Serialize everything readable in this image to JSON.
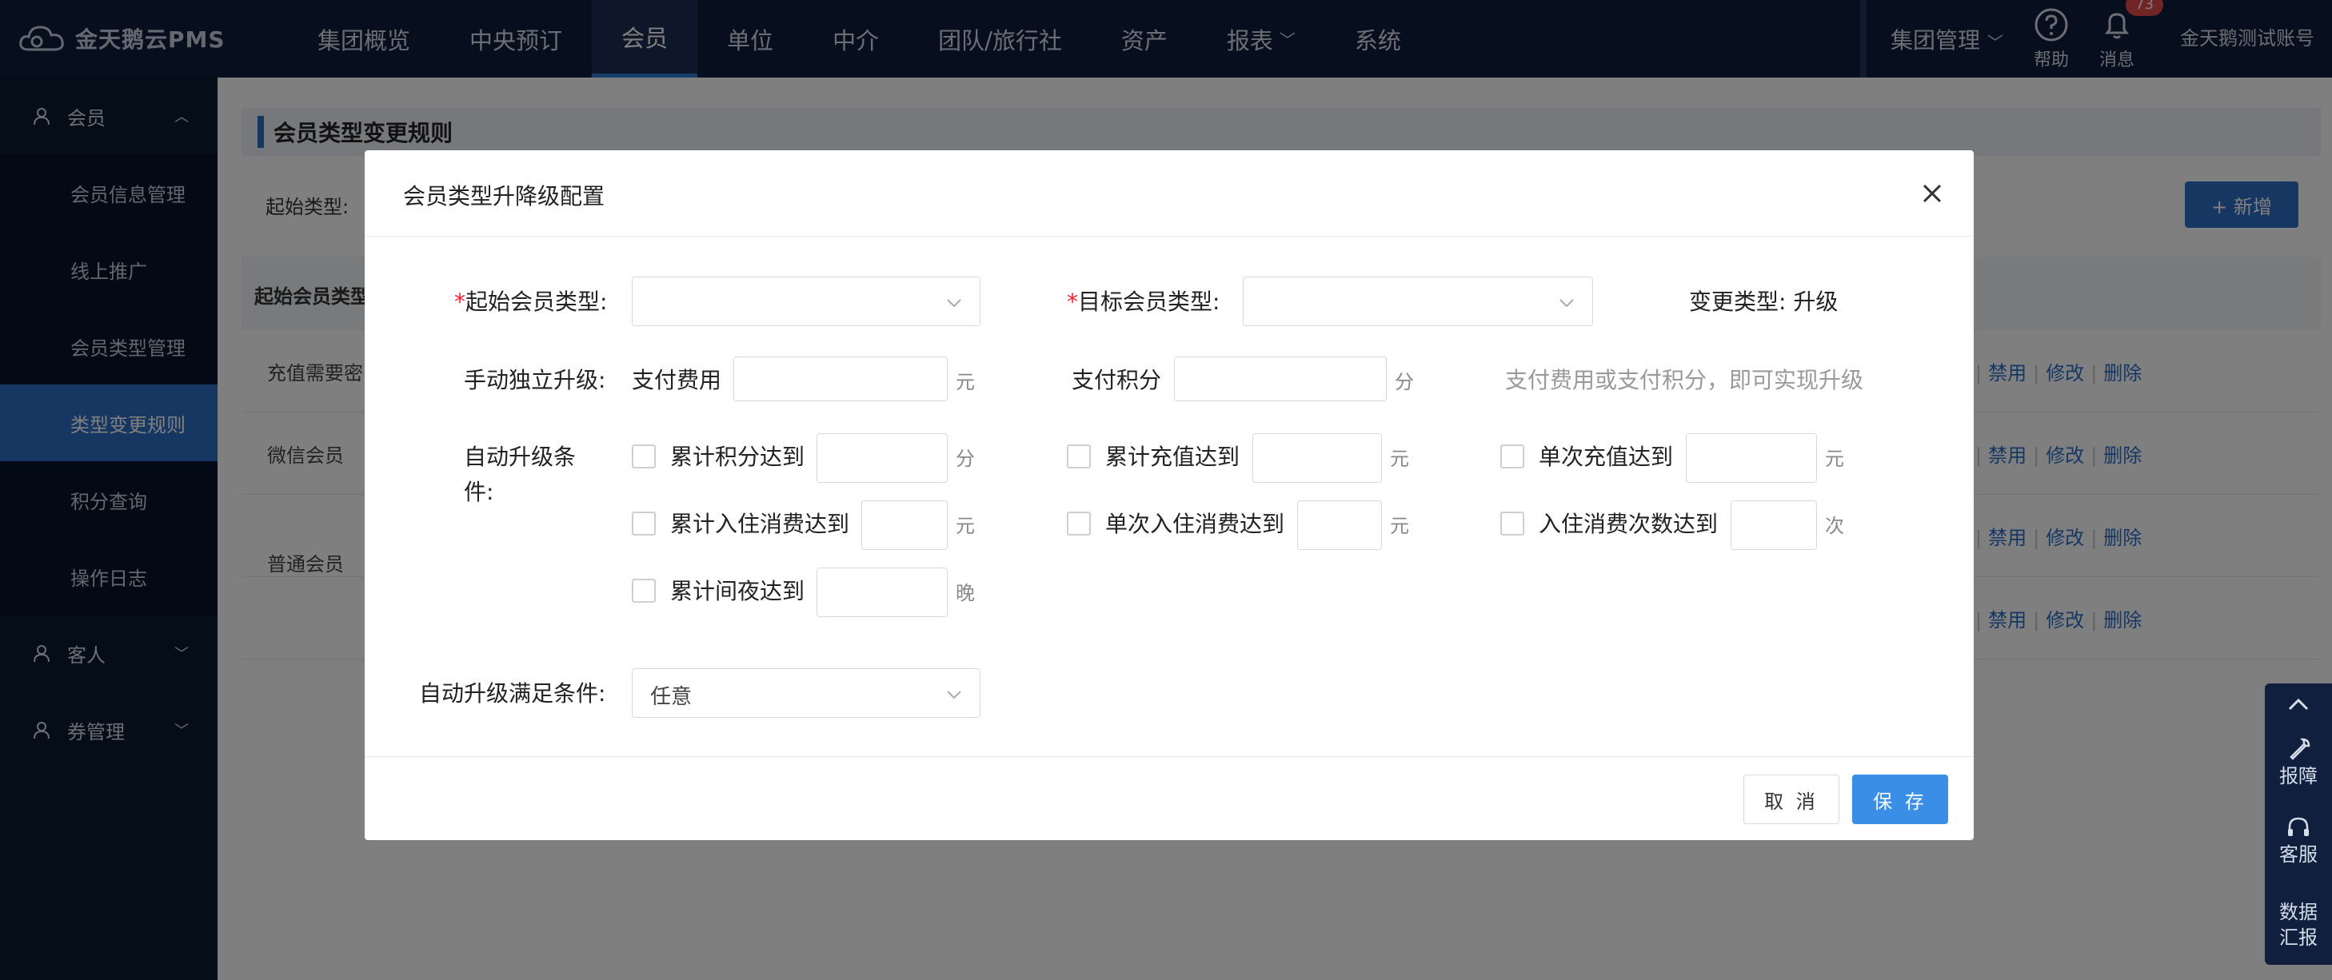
{
  "app": {
    "logo_text": "金天鹅云PMS"
  },
  "nav": {
    "items": [
      {
        "label": "集团概览"
      },
      {
        "label": "中央预订"
      },
      {
        "label": "会员",
        "active": true
      },
      {
        "label": "单位"
      },
      {
        "label": "中介"
      },
      {
        "label": "团队/旅行社"
      },
      {
        "label": "资产"
      },
      {
        "label": "报表",
        "dropdown": true
      },
      {
        "label": "系统"
      }
    ],
    "group_mgmt": "集团管理",
    "help": "帮助",
    "messages": "消息",
    "message_count": "73",
    "account": "金天鹅测试账号"
  },
  "sidebar": {
    "group_member": "会员",
    "items": [
      "会员信息管理",
      "线上推广",
      "会员类型管理",
      "类型变更规则",
      "积分查询",
      "操作日志"
    ],
    "active_index": 3,
    "group_guest": "客人",
    "group_coupon": "券管理"
  },
  "page": {
    "title": "会员类型变更规则",
    "filter_label": "起始类型:",
    "add_button": "+ 新增",
    "col0": "起始会员类型",
    "rows": [
      "充值需要密",
      "微信会员",
      "",
      "普通会员"
    ],
    "actions": {
      "disable": "禁用",
      "edit": "修改",
      "delete": "删除"
    }
  },
  "modal": {
    "title": "会员类型升降级配置",
    "start_type_label": "起始会员类型:",
    "target_type_label": "目标会员类型:",
    "change_type": "变更类型: 升级",
    "manual_label": "手动独立升级:",
    "pay_fee_label": "支付费用",
    "unit_yuan": "元",
    "pay_points_label": "支付积分",
    "unit_fen": "分",
    "manual_hint": "支付费用或支付积分，即可实现升级",
    "auto_label_1": "自动升级条",
    "auto_label_2": "件:",
    "conditions": {
      "points": "累计积分达到",
      "recharge_total": "累计充值达到",
      "recharge_single": "单次充值达到",
      "stay_spend_total": "累计入住消费达到",
      "stay_spend_single": "单次入住消费达到",
      "stay_count": "入住消费次数达到",
      "nights": "累计间夜达到"
    },
    "unit_ci": "次",
    "unit_wan": "晚",
    "satisfy_label": "自动升级满足条件:",
    "satisfy_value": "任意",
    "cancel": "取 消",
    "save": "保 存"
  },
  "float_panel": {
    "report": "报障",
    "service": "客服",
    "data_1": "数据",
    "data_2": "汇报"
  }
}
